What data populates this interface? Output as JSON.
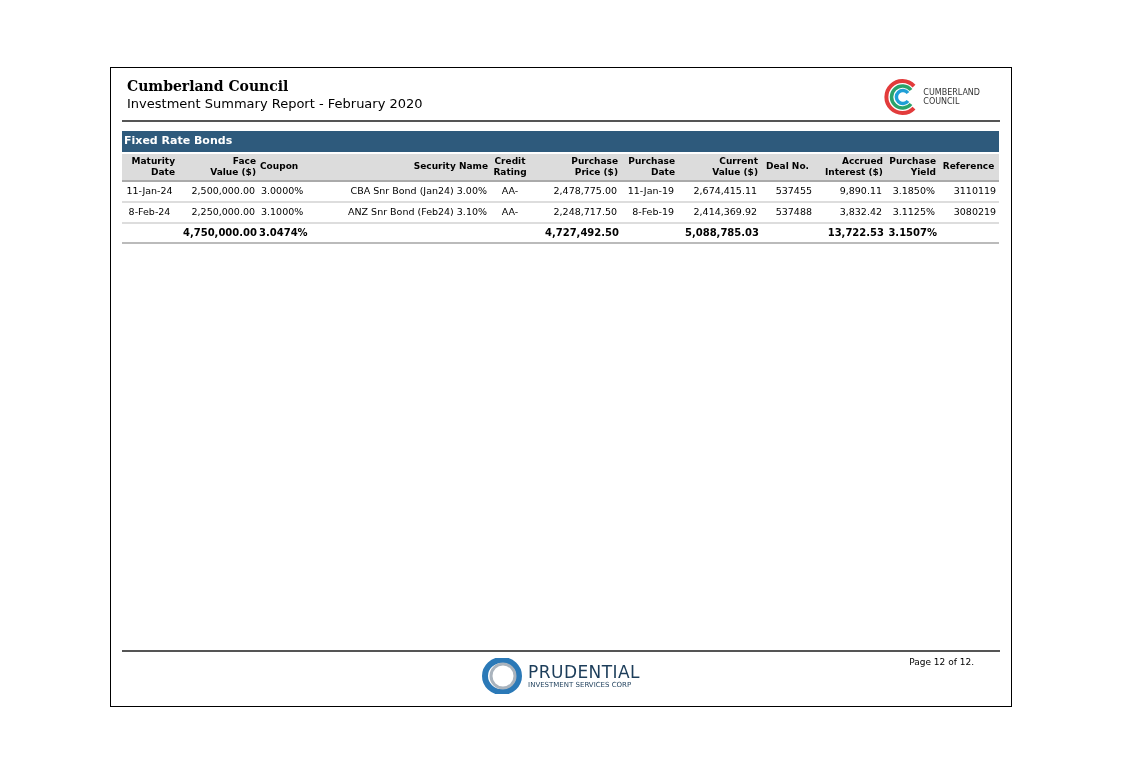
{
  "header": {
    "organization": "Cumberland Council",
    "report_title": "Investment Summary Report - February 2020",
    "logo_text": [
      "CUMBERLAND",
      "COUNCIL"
    ]
  },
  "section": {
    "title": "Fixed Rate Bonds",
    "columns": [
      "Maturity Date",
      "Face Value ($)",
      "Coupon",
      "Security Name",
      "Credit Rating",
      "Purchase Price ($)",
      "Purchase Date",
      "Current Value ($)",
      "Deal No.",
      "Accrued Interest ($)",
      "Purchase Yield",
      "Reference"
    ],
    "rows": [
      [
        "11-Jan-24",
        "2,500,000.00",
        "3.0000%",
        "CBA Snr Bond (Jan24) 3.00%",
        "AA-",
        "2,478,775.00",
        "11-Jan-19",
        "2,674,415.11",
        "537455",
        "9,890.11",
        "3.1850%",
        "3110119"
      ],
      [
        "8-Feb-24",
        "2,250,000.00",
        "3.1000%",
        "ANZ Snr Bond (Feb24) 3.10%",
        "AA-",
        "2,248,717.50",
        "8-Feb-19",
        "2,414,369.92",
        "537488",
        "3,832.42",
        "3.1125%",
        "3080219"
      ]
    ],
    "totals": [
      "4,750,000.00",
      "3.0474%",
      "4,727,492.50",
      "5,088,785.03",
      "13,722.53",
      "3.1507%"
    ]
  },
  "footer": {
    "logo_name": "PRUDENTIAL",
    "logo_tagline": "INVESTMENT SERVICES CORP",
    "page": "Page 12 of 12."
  }
}
